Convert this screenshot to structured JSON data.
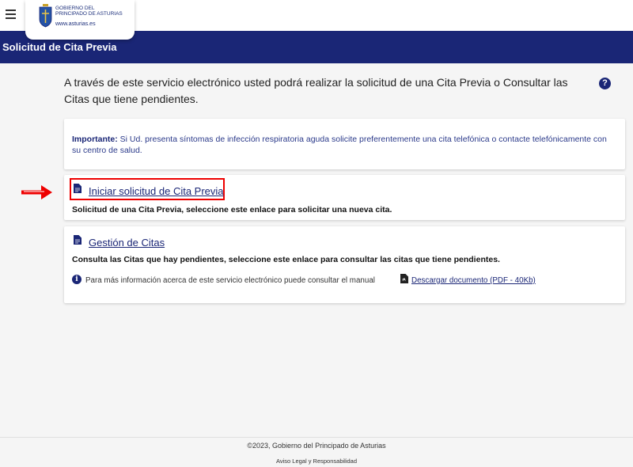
{
  "header": {
    "logo": {
      "line1": "Gobierno del",
      "line2": "Principado de Asturias",
      "url": "www.asturias.es"
    },
    "menu_icon": "hamburger-icon"
  },
  "title_bar": {
    "title": "Solicitud de Cita Previa"
  },
  "intro": {
    "text": "A través de este servicio electrónico usted podrá realizar la solicitud de una Cita Previa o Consultar las Citas que tiene pendientes.",
    "help_icon": "question-circle-icon"
  },
  "important": {
    "label": "Importante:",
    "text": " Si Ud. presenta síntomas de infección respiratoria aguda solicite preferentemente una cita telefónica o contacte telefónicamente con su centro de salud."
  },
  "cards": [
    {
      "link": "Iniciar solicitud de Cita Previa",
      "description": "Solicitud de una Cita Previa, seleccione este enlace para solicitar una nueva cita.",
      "highlighted": true
    },
    {
      "link": "Gestión de Citas",
      "description": "Consulta las Citas que hay pendientes, seleccione este enlace para consultar las citas que tiene pendientes.",
      "info_text": "Para más información acerca de este servicio electrónico puede consultar el manual",
      "download_link": "Descargar documento (PDF - 40Kb)"
    }
  ],
  "footer": {
    "copyright": "©2023, Gobierno del Principado de Asturias",
    "legal": "Aviso Legal y Responsabilidad"
  },
  "colors": {
    "brand_blue": "#1a2676",
    "highlight_red": "#e00000",
    "background": "#f5f5f5"
  }
}
